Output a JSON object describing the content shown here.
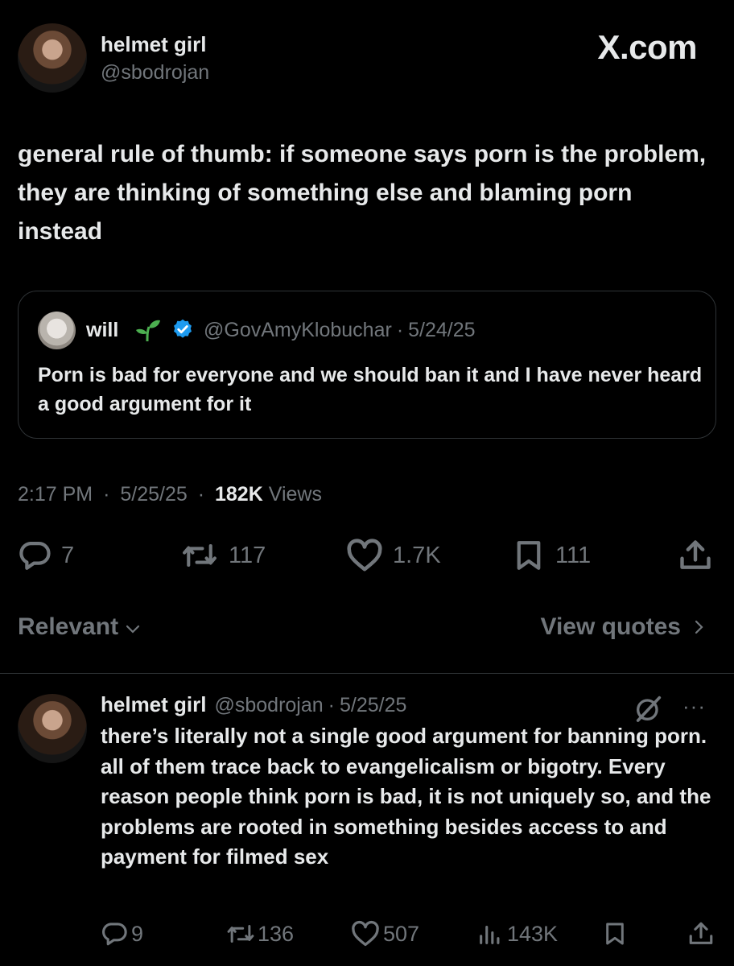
{
  "header": {
    "display_name": "helmet girl",
    "handle": "@sbodrojan",
    "brand": "X.com"
  },
  "tweet": {
    "text": "general rule of thumb: if someone says porn is the problem, they are thinking of something else and blaming porn instead",
    "time": "2:17 PM",
    "date": "5/25/25",
    "views_count": "182K",
    "views_label": "Views",
    "separator": "·"
  },
  "quote": {
    "name": "will",
    "handle": "@GovAmyKlobuchar",
    "date": "5/24/25",
    "text": "Porn is bad for everyone and we should ban it and I have never heard a good argument for it",
    "verified": true
  },
  "actions": {
    "replies": "7",
    "reposts": "117",
    "likes": "1.7K",
    "bookmarks": "111"
  },
  "sort": {
    "label": "Relevant",
    "view_quotes": "View quotes"
  },
  "reply": {
    "display_name": "helmet girl",
    "handle": "@sbodrojan",
    "date": "5/25/25",
    "text": "there’s literally not a single good argument for banning porn. all of them trace back to evangelicalism or bigotry. Every reason people think porn is bad, it is not uniquely so, and the problems are rooted in something besides access to and payment for filmed sex",
    "more": "···",
    "actions": {
      "replies": "9",
      "reposts": "136",
      "likes": "507",
      "views": "143K"
    }
  },
  "colors": {
    "background": "#000000",
    "text": "#e7e9ea",
    "muted": "#71767b",
    "border": "#2f3336",
    "verified": "#1d9bf0",
    "sprout": "#4caf50"
  }
}
